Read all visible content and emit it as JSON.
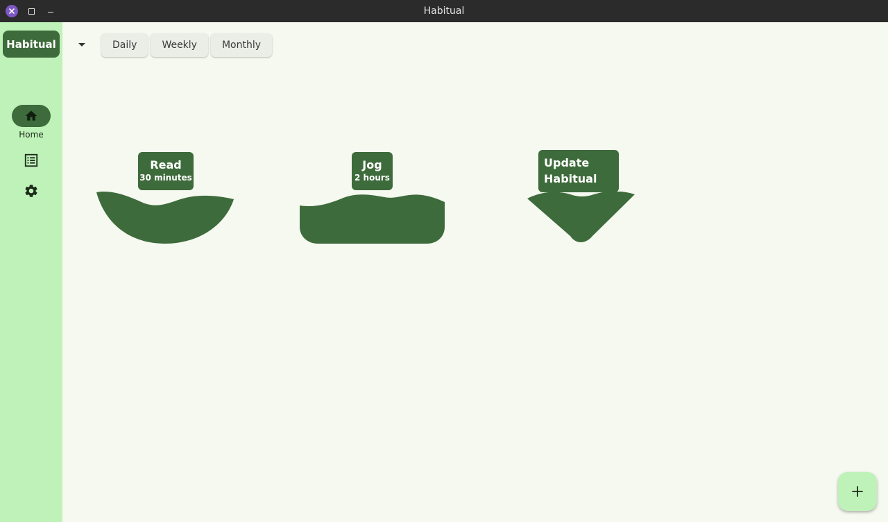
{
  "window": {
    "title": "Habitual"
  },
  "sidebar": {
    "brand": "Habitual",
    "home_label": "Home"
  },
  "header": {
    "tabs": [
      {
        "label": "Daily"
      },
      {
        "label": "Weekly"
      },
      {
        "label": "Monthly"
      }
    ]
  },
  "habits": [
    {
      "name": "Read",
      "detail": "30 minutes"
    },
    {
      "name": "Jog",
      "detail": "2 hours"
    },
    {
      "name": "Update Habitual",
      "detail": ""
    }
  ],
  "colors": {
    "accent": "#3e6b3b",
    "sidebar": "#bff2b8",
    "background": "#f5f9f0"
  },
  "icons": {
    "close": "close-icon",
    "maximize": "maximize-icon",
    "minimize": "minimize-icon",
    "home": "home-icon",
    "list": "list-icon",
    "settings": "gear-icon",
    "dropdown": "chevron-down-icon",
    "add": "plus-icon"
  }
}
